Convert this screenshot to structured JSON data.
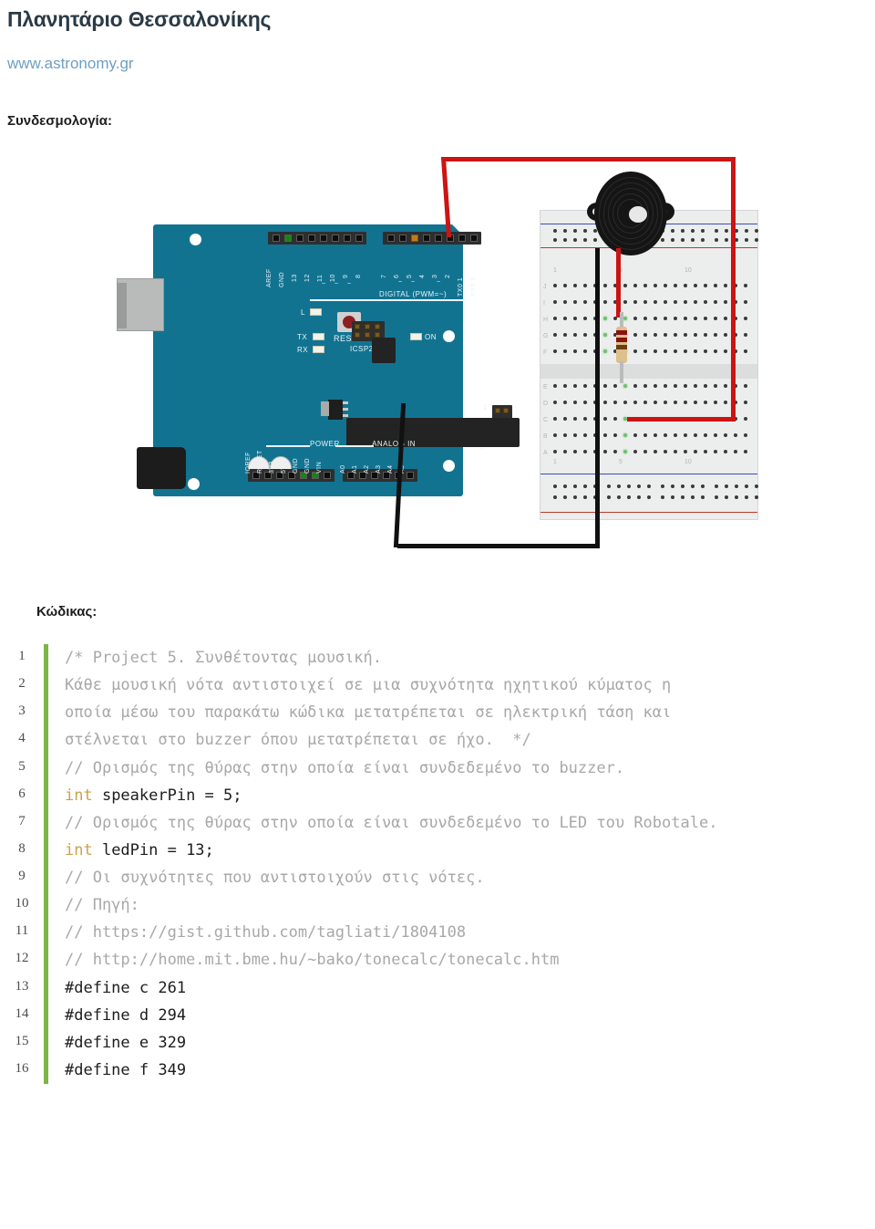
{
  "header": {
    "title": "Πλανητάριο Θεσσαλονίκης",
    "url": "www.astronomy.gr",
    "section_label": "Συνδεσμολογία:",
    "code_label": "Κώδικας:",
    "link_color": "#6d9fc4"
  },
  "diagram": {
    "name": "arduino-buzzer-breadboard-wiring",
    "board": {
      "name": "Arduino Uno",
      "color": "#127391",
      "reset_label": "RESET",
      "icsp2_label": "ICSP2",
      "icsp_label": "ICSP",
      "icsp_pin1_label": "1",
      "on_label": "ON",
      "l_label": "L",
      "tx_label": "TX",
      "rx_label": "RX",
      "digital_label": "DIGITAL (PWM=~)",
      "power_label": "POWER",
      "analog_label": "ANALOG IN",
      "digital_pins_left": [
        "AREF",
        "GND",
        "13",
        "12",
        "11",
        "10",
        "9",
        "8"
      ],
      "digital_pins_left_pwm": [
        "",
        "",
        "",
        "~",
        "~",
        "~",
        "~",
        ""
      ],
      "digital_pins_right": [
        "7",
        "6",
        "5",
        "4",
        "3",
        "2",
        "TX0 1",
        "RX0 0"
      ],
      "digital_pins_right_pwm": [
        "",
        "~",
        "~",
        "",
        "~",
        "",
        "",
        ""
      ],
      "power_pins": [
        "IOREF",
        "RESET",
        "3V3",
        "5V",
        "GND",
        "GND",
        "VIN"
      ],
      "analog_pins": [
        "A0",
        "A1",
        "A2",
        "A3",
        "A4",
        "A5"
      ]
    },
    "breadboard": {
      "column_numbers": [
        "1",
        "5",
        "10"
      ],
      "row_letters_top": [
        "J",
        "I",
        "H",
        "G",
        "F"
      ],
      "row_letters_bottom": [
        "E",
        "D",
        "C",
        "B",
        "A"
      ],
      "rail_positive_color": "#c0392b",
      "rail_negative_color": "#3b4cc0"
    },
    "components": {
      "buzzer_name": "piezo-buzzer",
      "resistor_name": "resistor",
      "resistor_bands": [
        "#8a1212",
        "#8a1212",
        "#6b3d12"
      ]
    },
    "wires": [
      {
        "name": "signal-wire",
        "color": "#cc1414",
        "from": "D5",
        "to": "breadboard"
      },
      {
        "name": "ground-wire",
        "color": "#111111",
        "from": "GND",
        "to": "breadboard"
      }
    ]
  },
  "code": {
    "language": "arduino",
    "comment_color": "#a8a8a8",
    "keyword_color": "#c9a24a",
    "gutter_bar_color": "#7ab648",
    "lines": [
      {
        "n": "1",
        "segments": [
          {
            "t": "/* Project 5. Συνθέτοντας μουσική.",
            "c": "cm"
          }
        ]
      },
      {
        "n": "2",
        "segments": [
          {
            "t": "Κάθε μουσική νότα αντιστοιχεί σε μια συχνότητα ηχητικού κύματος η",
            "c": "cm"
          }
        ]
      },
      {
        "n": "3",
        "segments": [
          {
            "t": "οποία μέσω του παρακάτω κώδικα μετατρέπεται σε ηλεκτρική τάση και",
            "c": "cm"
          }
        ]
      },
      {
        "n": "4",
        "segments": [
          {
            "t": "στέλνεται στο buzzer όπου μετατρέπεται σε ήχο.  */",
            "c": "cm"
          }
        ]
      },
      {
        "n": "5",
        "segments": [
          {
            "t": "// Ορισμός της θύρας στην οποία είναι συνδεδεμένο το buzzer.",
            "c": "cm"
          }
        ]
      },
      {
        "n": "6",
        "segments": [
          {
            "t": "int",
            "c": "kw"
          },
          {
            "t": " speakerPin = 5;",
            "c": ""
          }
        ]
      },
      {
        "n": "7",
        "segments": [
          {
            "t": "// Ορισμός της θύρας στην οποία είναι συνδεδεμένο το LED του Robotale.",
            "c": "cm"
          }
        ]
      },
      {
        "n": "8",
        "segments": [
          {
            "t": "int",
            "c": "kw"
          },
          {
            "t": " ledPin = 13;",
            "c": ""
          }
        ]
      },
      {
        "n": "9",
        "segments": [
          {
            "t": "// Οι συχνότητες που αντιστοιχούν στις νότες.",
            "c": "cm"
          }
        ]
      },
      {
        "n": "10",
        "segments": [
          {
            "t": "// Πηγή:",
            "c": "cm"
          }
        ]
      },
      {
        "n": "11",
        "segments": [
          {
            "t": "// https://gist.github.com/tagliati/1804108",
            "c": "cm"
          }
        ]
      },
      {
        "n": "12",
        "segments": [
          {
            "t": "// http://home.mit.bme.hu/~bako/tonecalc/tonecalc.htm",
            "c": "cm"
          }
        ]
      },
      {
        "n": "13",
        "segments": [
          {
            "t": "#define c 261",
            "c": ""
          }
        ]
      },
      {
        "n": "14",
        "segments": [
          {
            "t": "#define d 294",
            "c": ""
          }
        ]
      },
      {
        "n": "15",
        "segments": [
          {
            "t": "#define e 329",
            "c": ""
          }
        ]
      },
      {
        "n": "16",
        "segments": [
          {
            "t": "#define f 349",
            "c": ""
          }
        ]
      }
    ]
  }
}
